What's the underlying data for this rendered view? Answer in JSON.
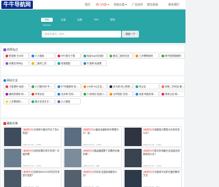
{
  "header": {
    "logo": "牛牛导航网",
    "nav": [
      {
        "label": "首页",
        "active": false
      },
      {
        "label": "热门内容 ▾",
        "active": true
      },
      {
        "label": "导航分类 ▾",
        "active": false
      },
      {
        "label": "广告合作",
        "active": false
      },
      {
        "label": "提交收录",
        "active": false
      },
      {
        "label": "联系我们",
        "active": false
      }
    ]
  },
  "search": {
    "tabs": [
      "导航",
      "百度",
      "谷歌",
      "360",
      "搜狗"
    ],
    "active_tab": 0,
    "extra_label": "Github",
    "placeholder": "搜索关键词，回车…",
    "button_label": "搜索一下"
  },
  "recommended": {
    "title": "热荐站点",
    "items": [
      {
        "label": "短视频·去水印",
        "color": "#e53935"
      },
      {
        "label": "小小搜索",
        "color": "#1e88e5"
      },
      {
        "label": "MP3音乐下载",
        "color": "#e91e63"
      },
      {
        "label": "免费logo在线制",
        "color": "#26a69a"
      },
      {
        "label": "爱站二维码在线",
        "color": "#4caf50"
      },
      {
        "label": "三步骤教程网",
        "color": "#fb8c00"
      },
      {
        "label": "蜂鸟短视频解析",
        "color": "#43a047"
      },
      {
        "label": "设置区块网址",
        "color": "#7e57c2"
      },
      {
        "label": "二维码工具",
        "color": "#ffb300"
      },
      {
        "label": "快速搜图",
        "color": "#00acc1"
      },
      {
        "label": "牛搜网·免费看",
        "color": "#1e88e5"
      }
    ]
  },
  "popular": {
    "title": "网站大全",
    "items": [
      {
        "label": "刀客源码·免费…",
        "color": "#e53935"
      },
      {
        "label": "小刀娱乐网·专…",
        "color": "#43a047"
      },
      {
        "label": "87年最新网·免…",
        "color": "#1e88e5"
      },
      {
        "label": "小k网·QQ主站…",
        "color": "#fb8c00"
      },
      {
        "label": "亚马逊·网上购物…",
        "color": "#212121"
      },
      {
        "label": "风云站",
        "color": "#26a69a"
      },
      {
        "label": "闲鱼二手网站·最…",
        "color": "#ff7043"
      },
      {
        "label": "最新资源库·网…",
        "color": "#8e24aa"
      },
      {
        "label": "有赞优品",
        "color": "#e53935"
      },
      {
        "label": "北京网·在线…",
        "color": "#1e88e5"
      },
      {
        "label": "小说网站·免费小…",
        "color": "#43a047"
      },
      {
        "label": "云吧电影·在线…",
        "color": "#fb8c00"
      },
      {
        "label": "百度·网盘收录…",
        "color": "#1e88e5"
      },
      {
        "label": "易家云站·精…",
        "color": "#e91e63"
      },
      {
        "label": "三步骤相网·…",
        "color": "#fdd835"
      },
      {
        "label": "图片在线文字…",
        "color": "#26a69a"
      },
      {
        "label": "小小搜搜",
        "color": "#7e57c2"
      }
    ]
  },
  "articles": {
    "title": "最新文章",
    "items": [
      {
        "tag": "[营销知识]",
        "title": "无线网卡驱动不见了怎么恢复？",
        "date": "2020-03-31",
        "views": "1,456",
        "thumb": "#3e4c5e"
      },
      {
        "tag": "[营销知识]",
        "title": "U盘启动盘制作步骤是什么？如…",
        "date": "2020-03-31",
        "views": "1,342",
        "thumb": "#5b6d80"
      },
      {
        "tag": "[营销知识]",
        "title": "电脑显示屏显示无信号怎么办？",
        "date": "2020-03-31",
        "views": "1,201",
        "thumb": "#2f3440"
      },
      {
        "tag": "[营销知识]",
        "title": "如何设置共享打印机？详细步骤",
        "date": "2020-03-31",
        "views": "1,110",
        "thumb": "#6a7d8f"
      },
      {
        "tag": "[营销知识]",
        "title": "路由器重置了设置的正确步骤…",
        "date": "2020-03-31",
        "views": "998",
        "thumb": "#7d8c9a"
      },
      {
        "tag": "[营销知识]",
        "title": "笔记本电脑无法连接无线网络怎么办？",
        "date": "2020-03-31",
        "views": "1,034",
        "thumb": "#3a4350"
      },
      {
        "tag": "[营销知识]",
        "title": "如何对Win10中的文件夹进行加密？",
        "date": "2020-03-31",
        "views": "942",
        "thumb": "#4a5868"
      },
      {
        "tag": "[营销知识]",
        "title": "手机无法连接电脑怎么办？",
        "date": "2020-03-31",
        "views": "876",
        "thumb": "#55606e"
      },
      {
        "tag": "[营销知识]",
        "title": "光驱读不出来光盘的解决方法",
        "date": "2020-03-31",
        "views": "812",
        "thumb": "#2c3a4a"
      }
    ]
  }
}
